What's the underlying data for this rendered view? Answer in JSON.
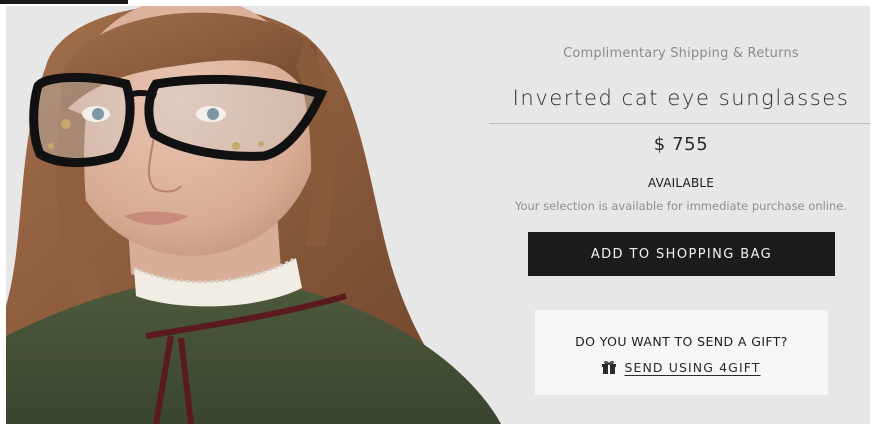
{
  "header": {
    "shipping_note": "Complimentary Shipping & Returns"
  },
  "product": {
    "title": "Inverted cat eye sunglasses",
    "price": "$ 755",
    "availability_status": "AVAILABLE",
    "availability_note": "Your selection is available for immediate purchase online."
  },
  "actions": {
    "add_to_bag_label": "ADD TO SHOPPING BAG"
  },
  "gift": {
    "question": "DO YOU WANT TO SEND A GIFT?",
    "link_label": "SEND USING 4GIFT",
    "icon": "gift-icon"
  },
  "colors": {
    "panel_background": "#e7e7e7",
    "button_background": "#1b1b1b",
    "gift_box_background": "#f6f6f6"
  }
}
